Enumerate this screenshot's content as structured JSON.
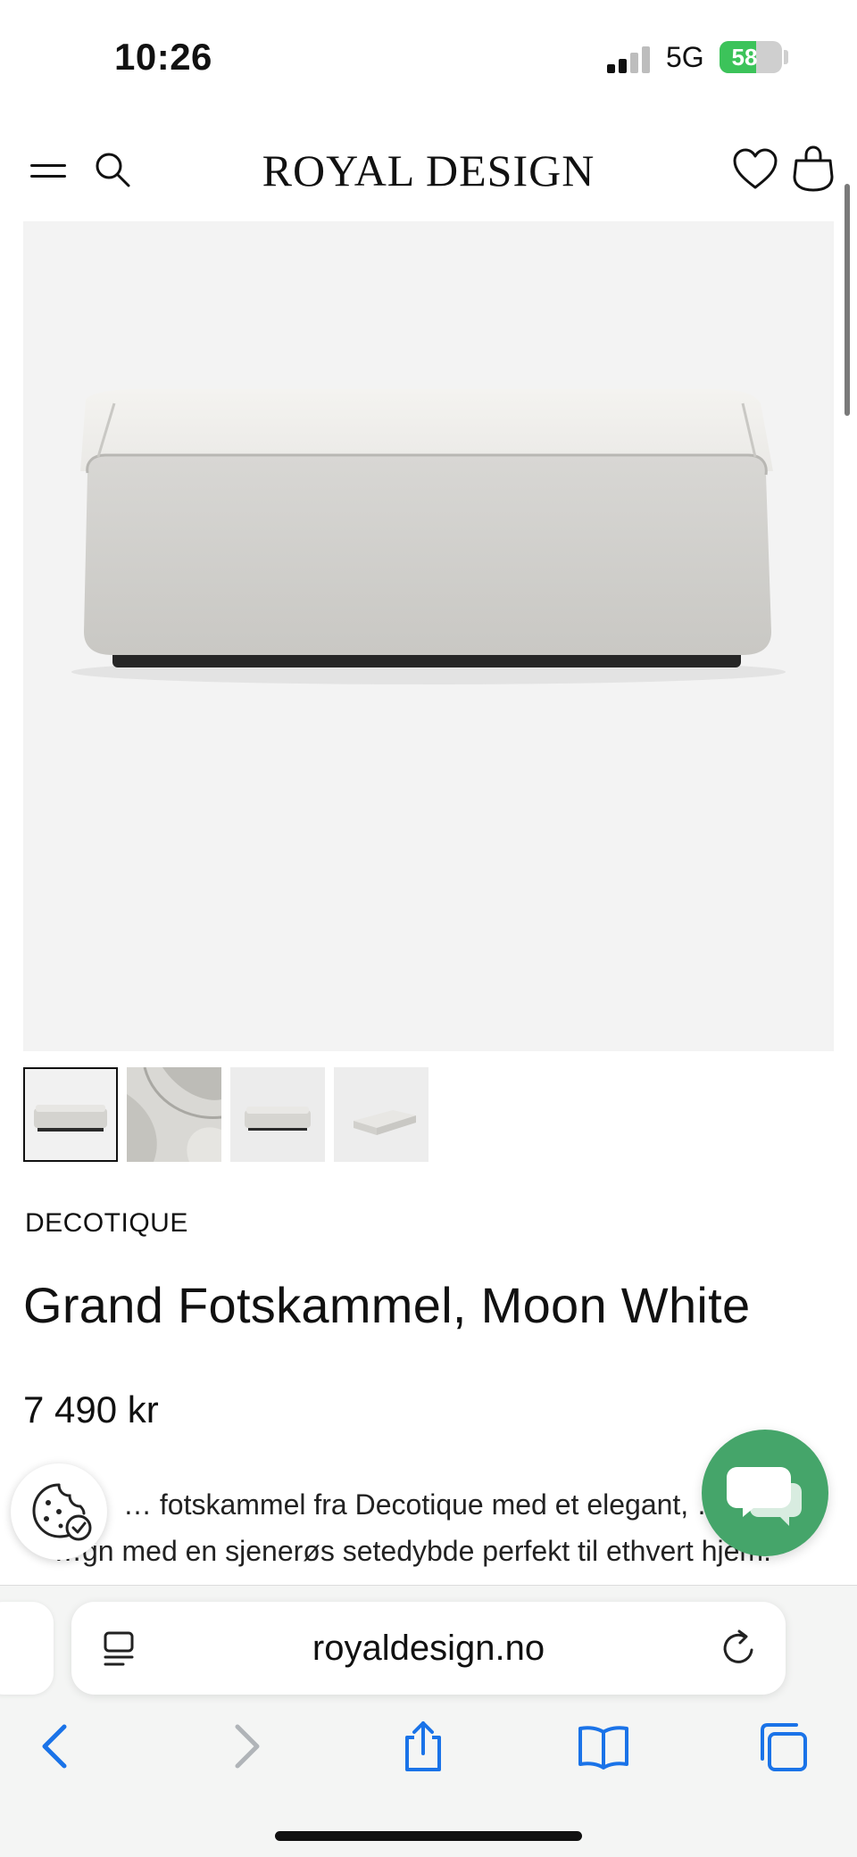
{
  "status_bar": {
    "time": "10:26",
    "network": "5G",
    "battery": "58",
    "battery_level": 0.58,
    "signal_bars": 2
  },
  "header": {
    "brand": "ROYAL DESIGN",
    "icons": [
      "menu-icon",
      "search-icon",
      "heart-icon",
      "shopping-bag-icon"
    ]
  },
  "product": {
    "brand": "DECOTIQUE",
    "title": "Grand Fotskammel, Moon White",
    "price": "7 490 kr",
    "description_line1": "… fotskammel fra Decotique med et elegant, …",
    "description_line2": "…gn med en sjenerøs setedybde perfekt til ethvert hjem.",
    "thumbnails": 4,
    "active_thumbnail": 1
  },
  "floating": {
    "cookie_icon": "cookie-settings-icon",
    "chat_icon": "chat-bubbles-icon"
  },
  "browser": {
    "url": "royaldesign.no",
    "icons": [
      "back-icon",
      "forward-icon",
      "share-icon",
      "bookmarks-icon",
      "tabs-icon"
    ]
  },
  "colors": {
    "accent_green": "#45a56a",
    "ios_blue": "#1a73e8",
    "battery_green": "#3cc35a"
  }
}
